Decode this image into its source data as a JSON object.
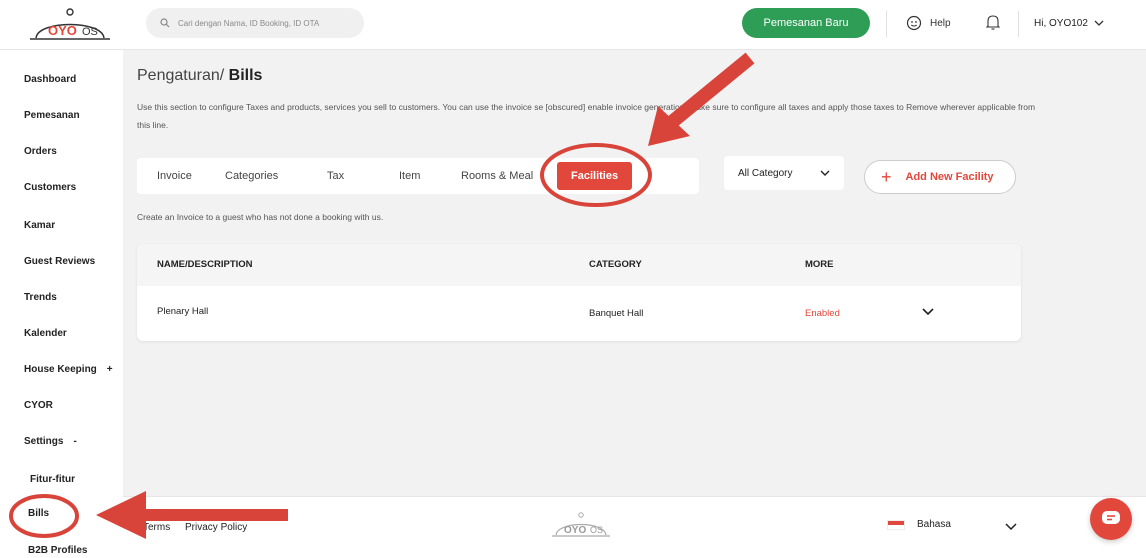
{
  "header": {
    "logo_text": "OYO OS",
    "search_placeholder": "Cari dengan Nama, ID Booking, ID OTA",
    "new_booking_label": "Pemesanan Baru",
    "help_label": "Help",
    "user_label": "Hi, OYO102"
  },
  "sidebar": {
    "items": [
      {
        "label": "Dashboard"
      },
      {
        "label": "Pemesanan"
      },
      {
        "label": "Orders"
      },
      {
        "label": "Customers"
      },
      {
        "label": "Kamar"
      },
      {
        "label": "Guest Reviews"
      },
      {
        "label": "Trends"
      },
      {
        "label": "Kalender"
      },
      {
        "label": "House Keeping",
        "toggle": "+"
      },
      {
        "label": "CYOR"
      },
      {
        "label": "Settings",
        "toggle": "-"
      },
      {
        "label": "Fitur-fitur"
      },
      {
        "label": "Bills"
      },
      {
        "label": "B2B Profiles"
      }
    ]
  },
  "page": {
    "breadcrumb_parent": "Pengaturan/",
    "breadcrumb_current": "Bills",
    "description": "Use this section to configure Taxes and products, services you sell to customers. You can use the invoice se [obscured] enable invoice generation. Make sure to configure all taxes and apply those taxes to Remove wherever applicable from this line.",
    "helper_text": "Create an Invoice to a guest who has not done a booking with us."
  },
  "tabs": [
    {
      "label": "Invoice",
      "active": false
    },
    {
      "label": "Categories",
      "active": false
    },
    {
      "label": "Tax",
      "active": false
    },
    {
      "label": "Item",
      "active": false
    },
    {
      "label": "Rooms & Meal",
      "active": false
    },
    {
      "label": "Facilities",
      "active": true
    }
  ],
  "filters": {
    "category_selected": "All Category",
    "add_button_label": "Add New Facility"
  },
  "table": {
    "columns": [
      "NAME/DESCRIPTION",
      "CATEGORY",
      "MORE"
    ],
    "rows": [
      {
        "name": "Plenary Hall",
        "category": "Banquet Hall",
        "status": "Enabled"
      }
    ]
  },
  "footer": {
    "links": [
      "Terms",
      "Privacy Policy"
    ],
    "language": "Bahasa"
  },
  "colors": {
    "accent_red": "#e2473b",
    "primary_green": "#2e9e57"
  }
}
